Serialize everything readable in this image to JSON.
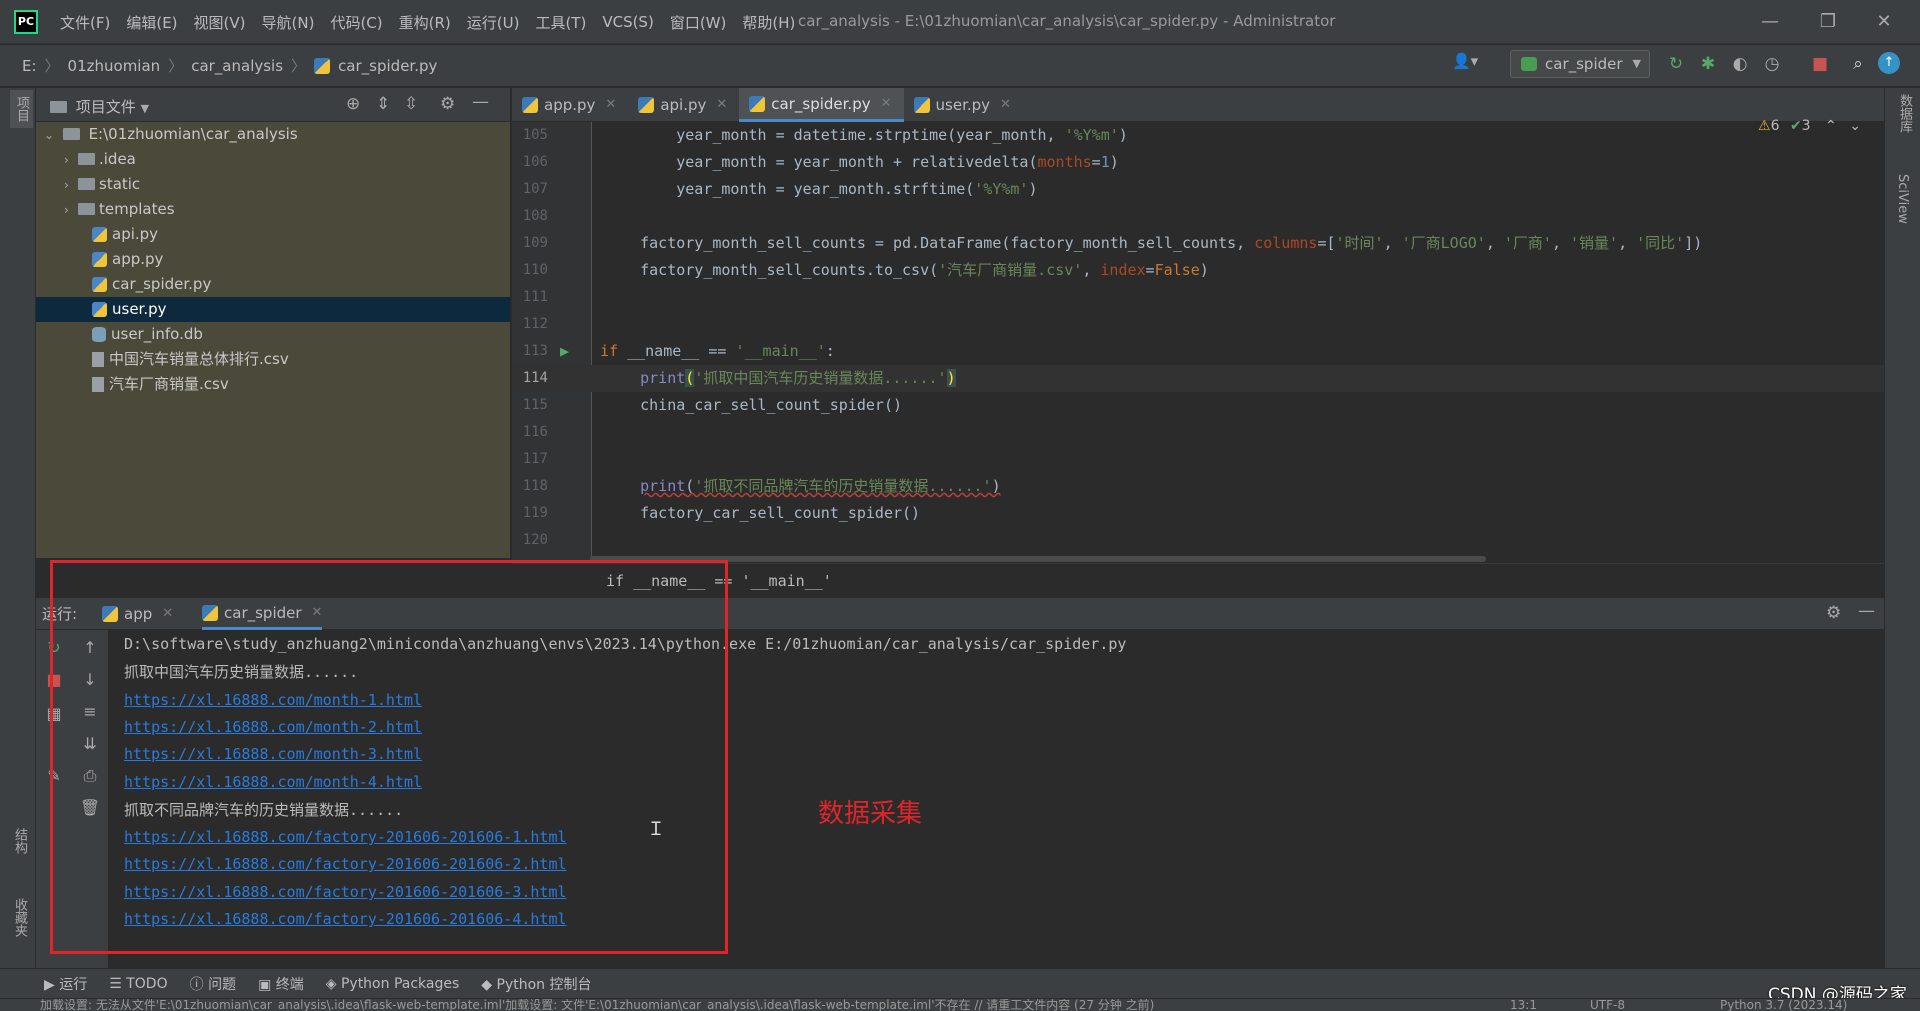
{
  "titlebar": {
    "logo": "PC",
    "menu": [
      "文件(F)",
      "编辑(E)",
      "视图(V)",
      "导航(N)",
      "代码(C)",
      "重构(R)",
      "运行(U)",
      "工具(T)",
      "VCS(S)",
      "窗口(W)",
      "帮助(H)"
    ],
    "window_title": "car_analysis - E:\\01zhuomian\\car_analysis\\car_spider.py - Administrator"
  },
  "navbar": {
    "drive": "E:",
    "crumbs": [
      "01zhuomian",
      "car_analysis",
      "car_spider.py"
    ],
    "run_config": "car_spider"
  },
  "left_strip": {
    "project_label": "项目",
    "structure_label": "结构",
    "favorites_label": "收藏夹"
  },
  "right_strip": {
    "database_label": "数据库",
    "sciview_label": "SciView"
  },
  "project": {
    "title": "项目文件",
    "root": "E:\\01zhuomian\\car_analysis",
    "items": [
      {
        "label": ".idea",
        "kind": "folder"
      },
      {
        "label": "static",
        "kind": "folder"
      },
      {
        "label": "templates",
        "kind": "folder"
      },
      {
        "label": "api.py",
        "kind": "py"
      },
      {
        "label": "app.py",
        "kind": "py"
      },
      {
        "label": "car_spider.py",
        "kind": "py"
      },
      {
        "label": "user.py",
        "kind": "py"
      },
      {
        "label": "user_info.db",
        "kind": "db"
      },
      {
        "label": "中国汽车销量总体排行.csv",
        "kind": "csv"
      },
      {
        "label": "汽车厂商销量.csv",
        "kind": "csv"
      }
    ],
    "selected_index": 6
  },
  "editor": {
    "tabs": [
      "app.py",
      "api.py",
      "car_spider.py",
      "user.py"
    ],
    "active_tab": 2,
    "warnings": "6",
    "weak_warnings": "3",
    "lines": [
      {
        "n": "105",
        "html_parts": [
          "            year_month = datetime.strptime(year_month, ",
          "'%Y%m'",
          ")"
        ]
      },
      {
        "n": "106"
      },
      {
        "n": "107"
      },
      {
        "n": "108"
      },
      {
        "n": "109"
      },
      {
        "n": "110"
      },
      {
        "n": "111"
      },
      {
        "n": "112"
      },
      {
        "n": "113"
      },
      {
        "n": "114"
      },
      {
        "n": "115"
      },
      {
        "n": "116"
      },
      {
        "n": "117"
      },
      {
        "n": "118"
      },
      {
        "n": "119"
      },
      {
        "n": "120"
      }
    ],
    "breadcrumb": "if __name__ == '__main__'"
  },
  "run": {
    "label": "运行:",
    "tabs": [
      "app",
      "car_spider"
    ],
    "active_tab": 1,
    "output": [
      {
        "text": "D:\\software\\study_anzhuang2\\miniconda\\anzhuang\\envs\\2023.14\\python.exe E:/01zhuomian/car_analysis/car_spider.py",
        "link": false
      },
      {
        "text": "抓取中国汽车历史销量数据......",
        "link": false
      },
      {
        "text": "https://xl.16888.com/month-1.html",
        "link": true
      },
      {
        "text": "https://xl.16888.com/month-2.html",
        "link": true
      },
      {
        "text": "https://xl.16888.com/month-3.html",
        "link": true
      },
      {
        "text": "https://xl.16888.com/month-4.html",
        "link": true
      },
      {
        "text": "抓取不同品牌汽车的历史销量数据......",
        "link": false
      },
      {
        "text": "https://xl.16888.com/factory-201606-201606-1.html",
        "link": true
      },
      {
        "text": "https://xl.16888.com/factory-201606-201606-2.html",
        "link": true
      },
      {
        "text": "https://xl.16888.com/factory-201606-201606-3.html",
        "link": true
      },
      {
        "text": "https://xl.16888.com/factory-201606-201606-4.html",
        "link": true
      }
    ],
    "annotation": "数据采集"
  },
  "bottom_tabs": [
    "运行",
    "TODO",
    "问题",
    "终端",
    "Python Packages",
    "Python 控制台"
  ],
  "statusbar": {
    "message": "加载设置: 无法从文件'E:\\01zhuomian\\car_analysis\\.idea\\flask-web-template.iml'加载设置: 文件'E:\\01zhuomian\\car_analysis\\.idea\\flask-web-template.iml'不存在 // 请重工文件内容 (27 分钟 之前)",
    "position": "13:1",
    "encoding": "UTF-8",
    "interpreter": "Python 3.7 (2023.14)"
  },
  "watermark": "CSDN @源码之家",
  "colors": {
    "accent": "#4a88c7",
    "annotation": "#e0252a",
    "link": "#287bde"
  }
}
